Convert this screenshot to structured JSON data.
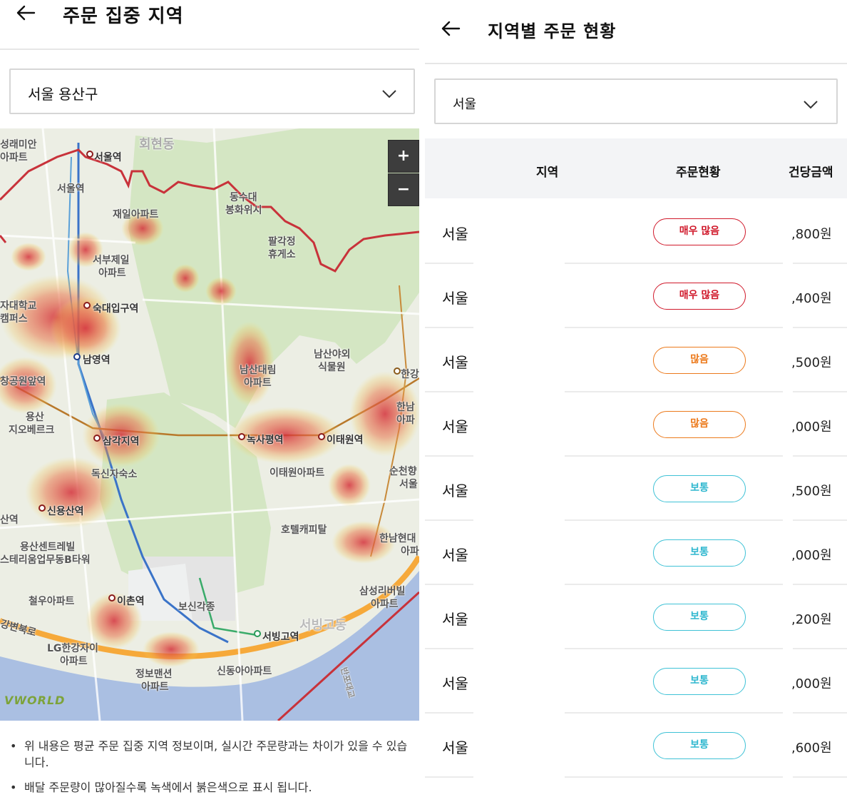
{
  "left_panel": {
    "title": "주문 집중 지역",
    "region_select": {
      "value": "서울 용산구"
    },
    "map": {
      "zoom_in_label": "+",
      "zoom_out_label": "−",
      "provider": "VWORLD",
      "labels": [
        "성래미안",
        "아파트",
        "서울역",
        "회현동",
        "서울역",
        "재일아파트",
        "동수대",
        "봉화위시",
        "팔각정",
        "휴게소",
        "서부제일",
        "아파트",
        "숙대입구역",
        "자대학교",
        "캠퍼스",
        "남영역",
        "남산야외",
        "식물원",
        "남산대림",
        "아파트",
        "한강",
        "창공원앞역",
        "용산",
        "지오베르크",
        "삼각지역",
        "녹사평역",
        "이태원역",
        "이태원아파트",
        "독신자숙소",
        "한남",
        "아파",
        "순천향",
        "서울",
        "신용산역",
        "산역",
        "호텔캐피탈",
        "용산센트레빌",
        "스테리움업무동B타워",
        "한남현대",
        "아파",
        "삼성리버빌",
        "아파트",
        "철우아파트",
        "이촌역",
        "보신각종",
        "서빙고역",
        "LG한강자이",
        "아파트",
        "정보맨션",
        "아파트",
        "신동아아파트",
        "강변북로",
        "서빙고동",
        "반포대교"
      ]
    },
    "notes": [
      "위 내용은 평균 주문 집중 지역 정보이며, 실시간 주문량과는 차이가 있을 수 있습니다.",
      "배달 주문량이 많아질수록 녹색에서 붉은색으로 표시 됩니다."
    ]
  },
  "right_panel": {
    "title": "지역별 주문 현황",
    "region_select": {
      "value": "서울"
    },
    "table": {
      "headers": {
        "region": "지역",
        "status": "주문현황",
        "price": "건당금액"
      },
      "rows": [
        {
          "region": "서울",
          "status": "매우 많음",
          "level": "very",
          "price": ",800원"
        },
        {
          "region": "서울",
          "status": "매우 많음",
          "level": "very",
          "price": ",400원"
        },
        {
          "region": "서울",
          "status": "많음",
          "level": "many",
          "price": ",500원"
        },
        {
          "region": "서울",
          "status": "많음",
          "level": "many",
          "price": ",000원"
        },
        {
          "region": "서울",
          "status": "보통",
          "level": "normal",
          "price": ",500원"
        },
        {
          "region": "서울",
          "status": "보통",
          "level": "normal",
          "price": ",000원"
        },
        {
          "region": "서울",
          "status": "보통",
          "level": "normal",
          "price": ",200원"
        },
        {
          "region": "서울",
          "status": "보통",
          "level": "normal",
          "price": ",000원"
        },
        {
          "region": "서울",
          "status": "보통",
          "level": "normal",
          "price": ",600원"
        }
      ]
    }
  },
  "colors": {
    "very_many": "#d0192b",
    "many": "#ec7a1c",
    "normal": "#3fc2d6",
    "boundary": "#c8323a",
    "heat": "#d93a3a"
  }
}
